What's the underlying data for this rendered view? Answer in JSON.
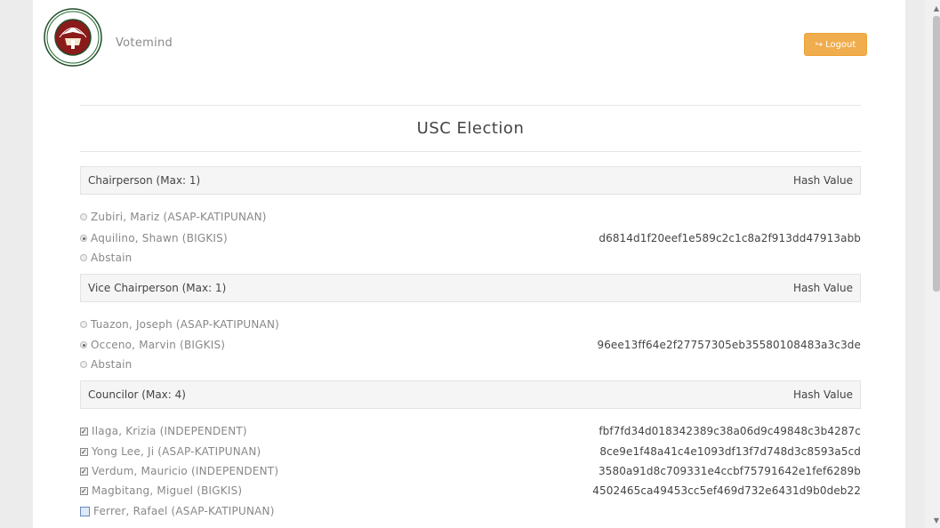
{
  "header": {
    "brand": "Votemind",
    "logout_label": "Logout",
    "logo_icon": "university-seal-logo",
    "logo_colors": {
      "ring": "#8b1a1a",
      "inner": "#ffffff",
      "accent": "#1f6b2e"
    }
  },
  "title": "USC Election",
  "colors": {
    "logout_button": "#f0ad4e"
  },
  "sections": [
    {
      "header": "Chairperson (Max: 1)",
      "hash_header": "Hash Value",
      "input_type": "radio",
      "candidates": [
        {
          "name": "Zubiri, Mariz (ASAP-KATIPUNAN)",
          "checked": false,
          "hash": ""
        },
        {
          "name": "Aquilino, Shawn (BIGKIS)",
          "checked": true,
          "hash": "d6814d1f20eef1e589c2c1c8a2f913dd47913abb"
        },
        {
          "name": "Abstain",
          "checked": false,
          "hash": ""
        }
      ]
    },
    {
      "header": "Vice Chairperson (Max: 1)",
      "hash_header": "Hash Value",
      "input_type": "radio",
      "candidates": [
        {
          "name": "Tuazon, Joseph (ASAP-KATIPUNAN)",
          "checked": false,
          "hash": ""
        },
        {
          "name": "Occeno, Marvin (BIGKIS)",
          "checked": true,
          "hash": "96ee13ff64e2f27757305eb35580108483a3c3de"
        },
        {
          "name": "Abstain",
          "checked": false,
          "hash": ""
        }
      ]
    },
    {
      "header": "Councilor (Max: 4)",
      "hash_header": "Hash Value",
      "input_type": "checkbox",
      "candidates": [
        {
          "name": "Ilaga, Krizia (INDEPENDENT)",
          "checked": true,
          "hash": "fbf7fd34d018342389c38a06d9c49848c3b4287c"
        },
        {
          "name": "Yong Lee, Ji (ASAP-KATIPUNAN)",
          "checked": true,
          "hash": "8ce9e1f48a41c4e1093df13f7d748d3c8593a5cd"
        },
        {
          "name": "Verdum, Mauricio (INDEPENDENT)",
          "checked": true,
          "hash": "3580a91d8c709331e4ccbf75791642e1fef6289b"
        },
        {
          "name": "Magbitang, Miguel (BIGKIS)",
          "checked": true,
          "hash": "4502465ca49453cc5ef469d732e6431d9b0deb22"
        },
        {
          "name": "Ferrer, Rafael (ASAP-KATIPUNAN)",
          "checked": false,
          "hash": ""
        }
      ]
    }
  ]
}
